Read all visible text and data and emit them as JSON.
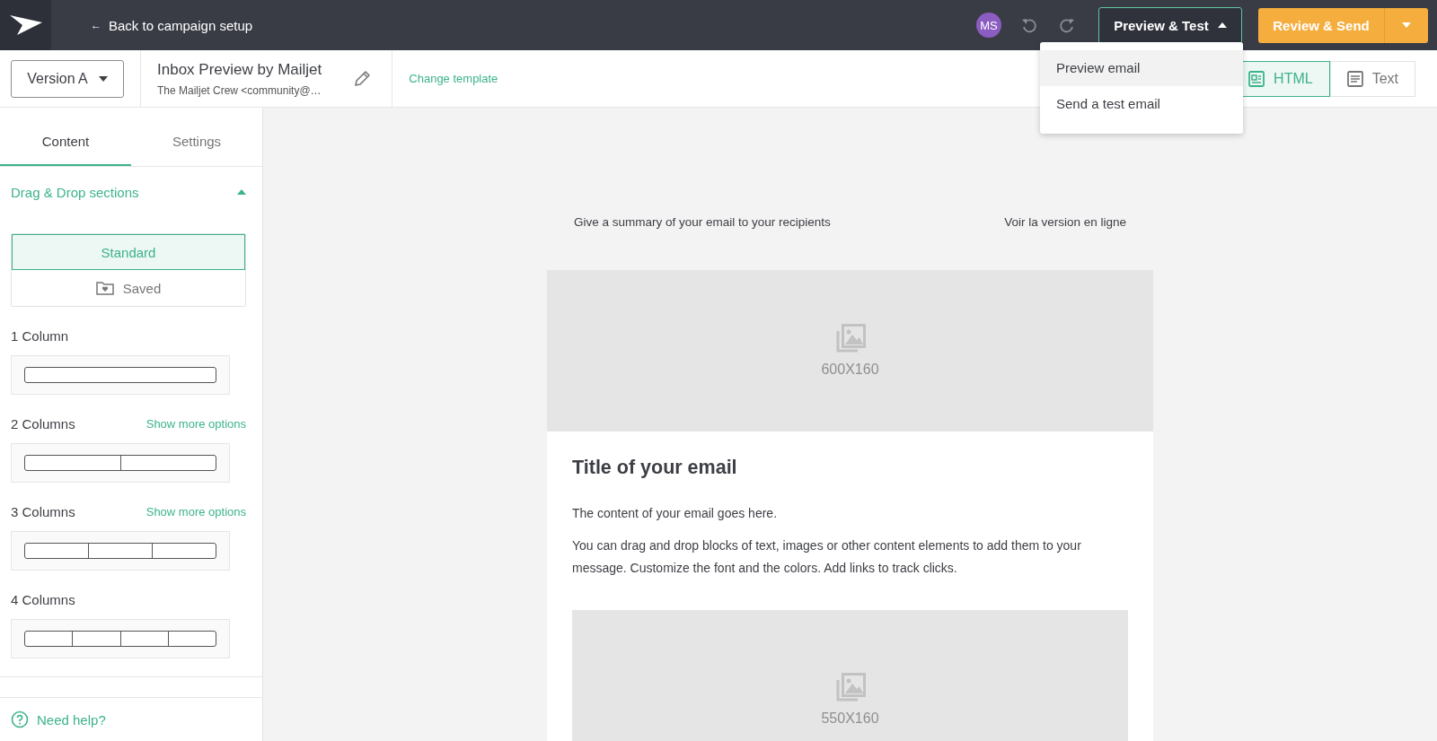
{
  "topbar": {
    "back_arrow": "←",
    "back_label": "Back to campaign setup",
    "avatar": "MS",
    "preview_button": {
      "label": "Preview & Test",
      "expanded": true
    },
    "send_button": "Review & Send"
  },
  "menu": [
    {
      "label": "Preview email",
      "selected": true
    },
    {
      "label": "Send a test email",
      "selected": false
    }
  ],
  "toolbar": {
    "version": "Version A",
    "title": "Inbox Preview by Mailjet",
    "sender": "The Mailjet Crew <community@…",
    "change_template": "Change template",
    "views": [
      {
        "kind": "html",
        "label": "HTML",
        "selected": true
      },
      {
        "kind": "text",
        "label": "Text",
        "selected": false
      }
    ]
  },
  "sidebar": {
    "tabs": [
      {
        "label": "Content",
        "selected": true
      },
      {
        "label": "Settings",
        "selected": false
      }
    ],
    "section": {
      "title": "Drag & Drop sections",
      "expanded": true
    },
    "library": [
      {
        "kind": "standard",
        "label": "Standard",
        "selected": true
      },
      {
        "kind": "saved",
        "label": "Saved",
        "selected": false
      }
    ],
    "layouts": [
      {
        "kind": "one",
        "label": "1 Column"
      },
      {
        "kind": "two",
        "label": "2 Columns",
        "more": "Show more options"
      },
      {
        "kind": "three",
        "label": "3 Columns",
        "more": "Show more options"
      },
      {
        "kind": "four",
        "label": "4 Columns"
      }
    ],
    "help": "Need help?"
  },
  "email": {
    "summary": "Give a summary of your email to your recipients",
    "web_version": "Voir la version en ligne",
    "header_image": "600X160",
    "title": "Title of your email",
    "paragraphs": [
      "The content of your email goes here.",
      "You can drag and drop blocks of text, images or other content elements to add them to your message. Customize the font and the colors. Add links to track clicks."
    ],
    "second_image": "550X160"
  }
}
